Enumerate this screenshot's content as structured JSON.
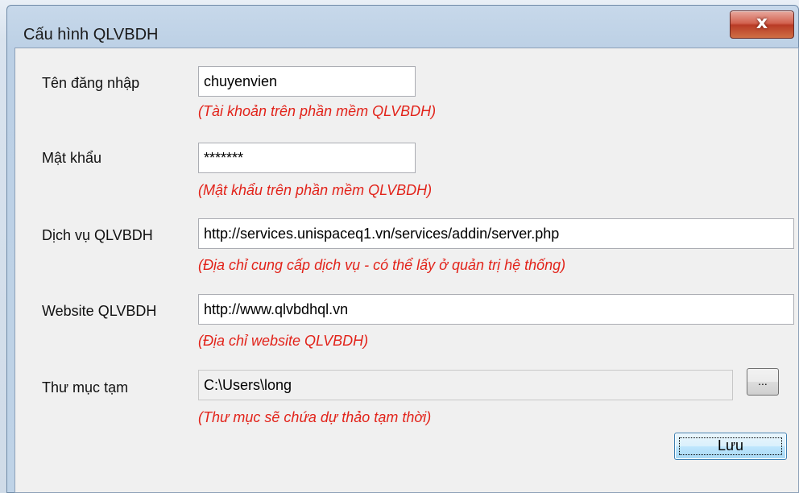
{
  "window": {
    "title": "Cấu hình QLVBDH",
    "close_glyph": "x"
  },
  "form": {
    "username": {
      "label": "Tên đăng nhập",
      "value": "chuyenvien",
      "hint": "(Tài khoản trên phần mềm QLVBDH)"
    },
    "password": {
      "label": "Mật khẩu",
      "value": "*******",
      "hint": "(Mật khẩu trên phần mềm QLVBDH)"
    },
    "service": {
      "label": "Dịch vụ QLVBDH",
      "value": "http://services.unispaceq1.vn/services/addin/server.php",
      "hint": "(Địa chỉ cung cấp dịch vụ - có thể lấy ở quản trị hệ thống)"
    },
    "website": {
      "label": "Website QLVBDH",
      "value": "http://www.qlvbdhql.vn",
      "hint": "(Địa chỉ website QLVBDH)"
    },
    "temp_folder": {
      "label": "Thư mục tạm",
      "value": "C:\\Users\\long",
      "hint": "(Thư mục sẽ chứa dự thảo tạm thời)",
      "browse_label": "..."
    }
  },
  "buttons": {
    "save_label": "Lưu"
  },
  "colors": {
    "hint": "#e2231a",
    "close_button": "#c9452f",
    "save_button": "#bee6fd"
  }
}
